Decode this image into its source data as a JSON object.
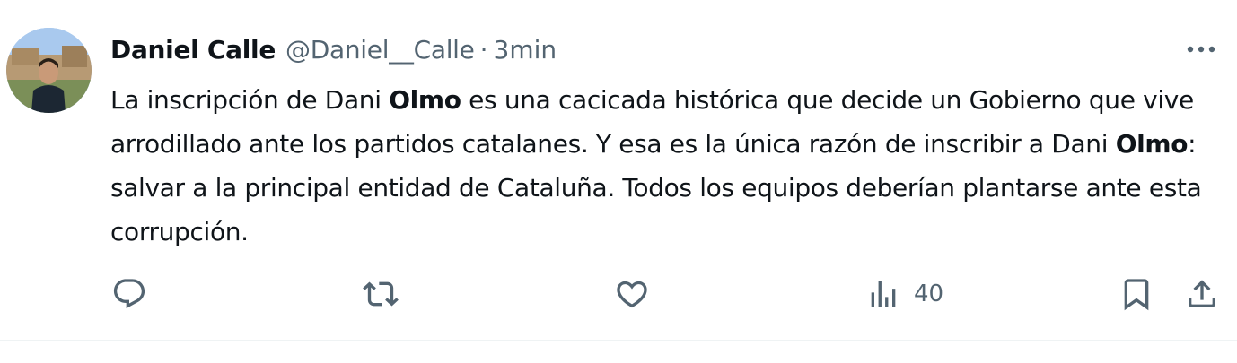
{
  "author": {
    "display_name": "Daniel Calle",
    "handle": "@Daniel__Calle",
    "separator": "·",
    "time": "3min"
  },
  "tweet": {
    "p1": "La inscripción de Dani ",
    "b1": "Olmo",
    "p2": " es una cacicada histórica que decide un Gobierno que vive arrodillado ante los partidos catalanes. Y esa es la única razón de inscribir a Dani ",
    "b2": "Olmo",
    "p3": ": salvar a la principal entidad de Cataluña. Todos los equipos deberían plantarse ante esta corrupción."
  },
  "actions": {
    "reply_icon": "reply-icon",
    "retweet_icon": "retweet-icon",
    "like_icon": "heart-icon",
    "views_icon": "views-chart-icon",
    "views_count": "40",
    "bookmark_icon": "bookmark-icon",
    "share_icon": "share-icon"
  },
  "colors": {
    "text_primary": "#0f1419",
    "text_secondary": "#536471",
    "divider": "#eff3f4"
  }
}
